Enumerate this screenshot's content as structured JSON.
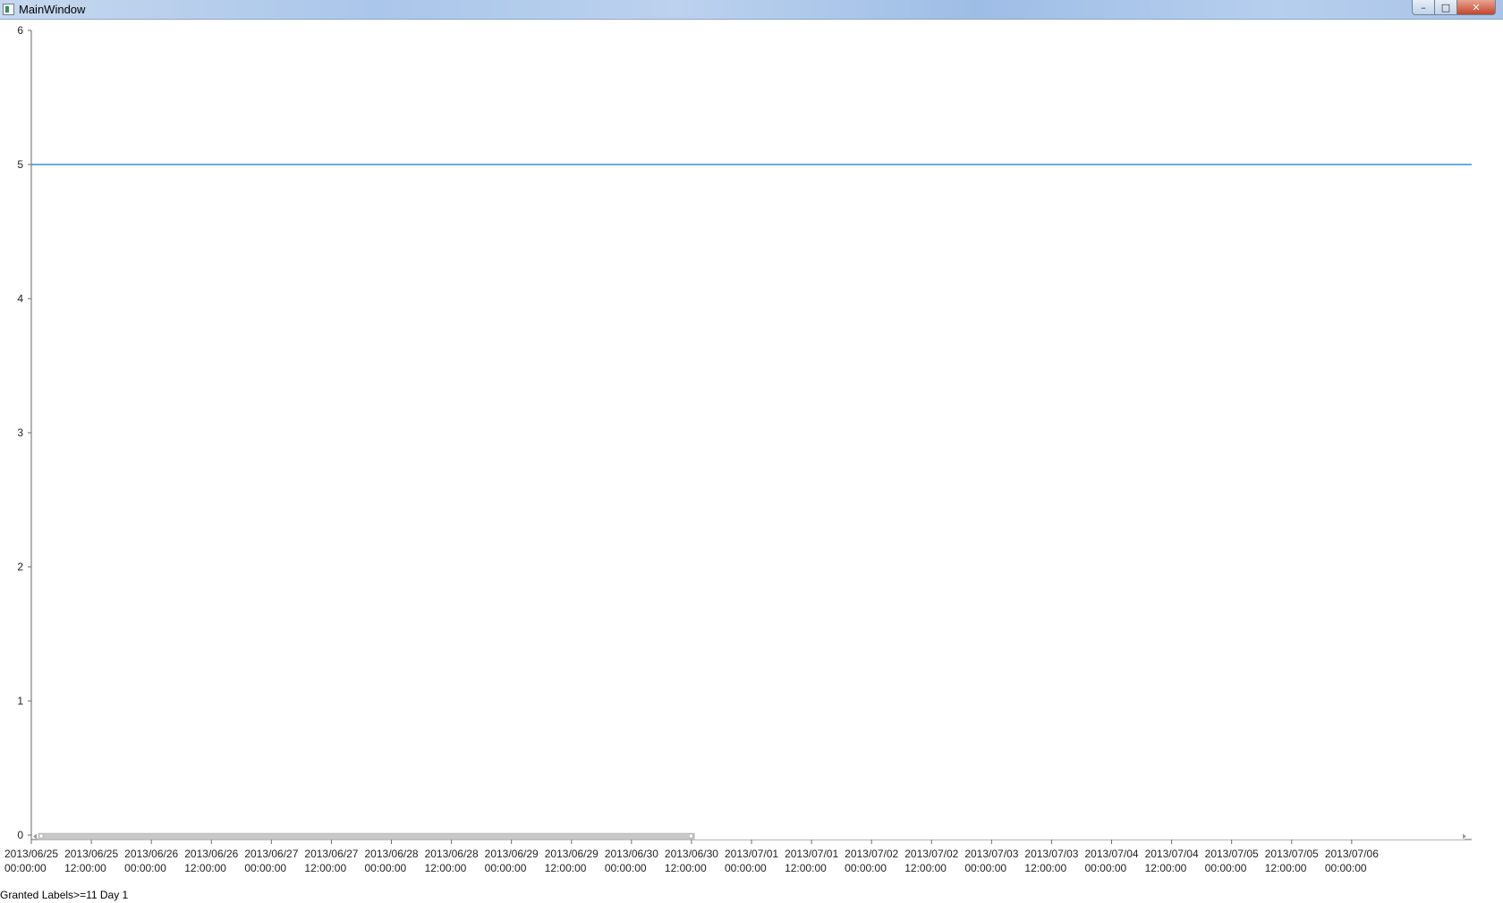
{
  "window": {
    "title": "MainWindow",
    "controls": {
      "minimize": "–",
      "maximize": "□",
      "close": "✕"
    }
  },
  "chart_data": {
    "type": "line",
    "title": "",
    "xlabel": "",
    "ylabel": "",
    "ylim": [
      0,
      6
    ],
    "y_ticks": [
      0,
      1,
      2,
      3,
      4,
      5,
      6
    ],
    "xlim": [
      "2013/06/25 00:00:00",
      "2013/07/07 00:00:00"
    ],
    "x_tick_labels": [
      "2013/06/25 00:00:00",
      "2013/06/25 12:00:00",
      "2013/06/26 00:00:00",
      "2013/06/26 12:00:00",
      "2013/06/27 00:00:00",
      "2013/06/27 12:00:00",
      "2013/06/28 00:00:00",
      "2013/06/28 12:00:00",
      "2013/06/29 00:00:00",
      "2013/06/29 12:00:00",
      "2013/06/30 00:00:00",
      "2013/06/30 12:00:00",
      "2013/07/01 00:00:00",
      "2013/07/01 12:00:00",
      "2013/07/02 00:00:00",
      "2013/07/02 12:00:00",
      "2013/07/03 00:00:00",
      "2013/07/03 12:00:00",
      "2013/07/04 00:00:00",
      "2013/07/04 12:00:00",
      "2013/07/05 00:00:00",
      "2013/07/05 12:00:00",
      "2013/07/06 00:00:00"
    ],
    "series": [
      {
        "color": "#3a8fd6",
        "points": [
          {
            "x": "2013/06/25 00:00:00",
            "y": 5
          },
          {
            "x": "2013/07/07 00:00:00",
            "y": 5
          }
        ]
      }
    ],
    "grid": false,
    "scrollbar": {
      "visible_fraction": 0.46,
      "position_fraction": 0
    }
  },
  "status": {
    "text": "Granted Labels>=11 Day 1"
  }
}
